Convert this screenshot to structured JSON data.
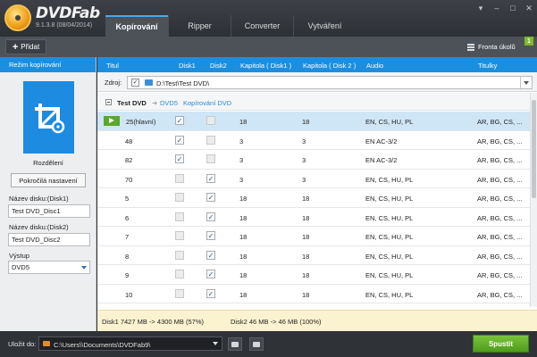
{
  "app": {
    "name": "DVDFab",
    "version": "9.1.3.8 (08/04/2014)"
  },
  "tabs": [
    {
      "label": "Kopírování",
      "active": true
    },
    {
      "label": "Ripper",
      "active": false
    },
    {
      "label": "Converter",
      "active": false
    },
    {
      "label": "Vytváření",
      "active": false
    }
  ],
  "window_controls": [
    "▾",
    "–",
    "□",
    "✕"
  ],
  "toolbar": {
    "add_label": "Přidat",
    "queue_label": "Fronta úkolů",
    "queue_count": "1"
  },
  "left_panel": {
    "header": "Režim kopírování",
    "mode_label": "Rozdělení",
    "advanced_button": "Pokročilá nastavení",
    "disc1_label": "Název disku:(Disk1)",
    "disc1_value": "Test DVD_Disc1",
    "disc2_label": "Název disku:(Disk2)",
    "disc2_value": "Test DVD_Disc2",
    "output_label": "Výstup",
    "output_value": "DVD5"
  },
  "columns": {
    "title": "Titul",
    "disk1": "Disk1",
    "disk2": "Disk2",
    "chapter1": "Kapitola ( Disk1 )",
    "chapter2": "Kapitola ( Disk 2 )",
    "audio": "Audio",
    "subtitles": "Titulky"
  },
  "source": {
    "label": "Zdroj:",
    "path": "D:\\Test\\Test DVD\\"
  },
  "tree": {
    "name": "Test DVD",
    "arrow": "➜",
    "format": "DVD5",
    "mode": "Kopírování DVD"
  },
  "rows": [
    {
      "title": "25(hlavní)",
      "disk1": true,
      "disk2": false,
      "ch1": "18",
      "ch2": "18",
      "audio": "EN, CS, HU, PL",
      "subs": "AR, BG, CS, ...",
      "selected": true,
      "play": true
    },
    {
      "title": "48",
      "disk1": true,
      "disk2": false,
      "ch1": "3",
      "ch2": "3",
      "audio": "EN AC-3/2",
      "subs": "AR, BG, CS, ...",
      "selected": false,
      "play": false
    },
    {
      "title": "82",
      "disk1": true,
      "disk2": false,
      "ch1": "3",
      "ch2": "3",
      "audio": "EN AC-3/2",
      "subs": "AR, BG, CS, ...",
      "selected": false,
      "play": false
    },
    {
      "title": "70",
      "disk1": false,
      "disk2": true,
      "ch1": "3",
      "ch2": "3",
      "audio": "EN, CS, HU, PL",
      "subs": "AR, BG, CS, ...",
      "selected": false,
      "play": false
    },
    {
      "title": "5",
      "disk1": false,
      "disk2": true,
      "ch1": "18",
      "ch2": "18",
      "audio": "EN, CS, HU, PL",
      "subs": "AR, BG, CS, ...",
      "selected": false,
      "play": false
    },
    {
      "title": "6",
      "disk1": false,
      "disk2": true,
      "ch1": "18",
      "ch2": "18",
      "audio": "EN, CS, HU, PL",
      "subs": "AR, BG, CS, ...",
      "selected": false,
      "play": false
    },
    {
      "title": "7",
      "disk1": false,
      "disk2": true,
      "ch1": "18",
      "ch2": "18",
      "audio": "EN, CS, HU, PL",
      "subs": "AR, BG, CS, ...",
      "selected": false,
      "play": false
    },
    {
      "title": "8",
      "disk1": false,
      "disk2": true,
      "ch1": "18",
      "ch2": "18",
      "audio": "EN, CS, HU, PL",
      "subs": "AR, BG, CS, ...",
      "selected": false,
      "play": false
    },
    {
      "title": "9",
      "disk1": false,
      "disk2": true,
      "ch1": "18",
      "ch2": "18",
      "audio": "EN, CS, HU, PL",
      "subs": "AR, BG, CS, ...",
      "selected": false,
      "play": false
    },
    {
      "title": "10",
      "disk1": false,
      "disk2": true,
      "ch1": "18",
      "ch2": "18",
      "audio": "EN, CS, HU, PL",
      "subs": "AR, BG, CS, ...",
      "selected": false,
      "play": false
    }
  ],
  "summary": {
    "disk1": "Disk1  7427 MB  ->  4300 MB  (57%)",
    "disk2": "Disk2  46 MB  ->  46 MB  (100%)"
  },
  "footer": {
    "save_label": "Uložit do:",
    "save_path": "C:\\Users\\\\Documents\\DVDFab9\\",
    "start_label": "Spustit"
  },
  "colors": {
    "accent_blue": "#1c8ee0",
    "start_green": "#5aa72a",
    "selected_row": "#cfe6f7",
    "summary_bg": "#fbf3cf"
  }
}
